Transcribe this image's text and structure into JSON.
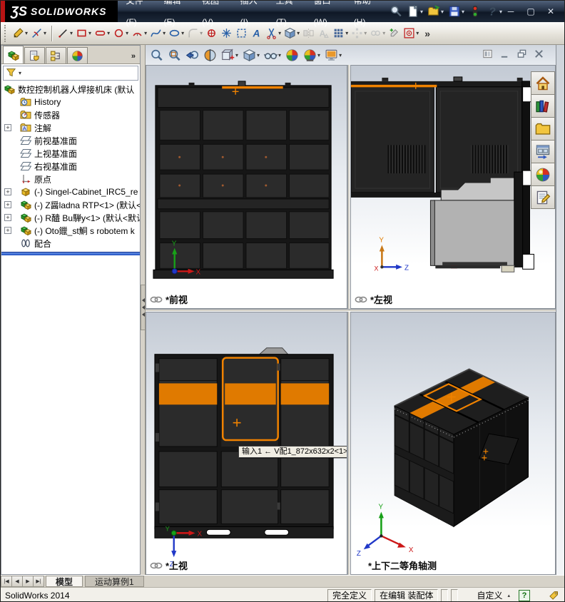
{
  "titlebar": {
    "logo_mark": "ƷS",
    "logo_text": "SOLIDWORKS",
    "menus": [
      "文件(F)",
      "编辑(E)",
      "视图(V)",
      "插入(I)",
      "工具(T)",
      "窗口(W)",
      "帮助(H)"
    ],
    "tools": [
      {
        "name": "search"
      },
      {
        "name": "new-document",
        "dd": true
      },
      {
        "name": "open-document",
        "dd": true
      },
      {
        "name": "save-document",
        "dd": true
      },
      {
        "name": "rebuild-light"
      },
      {
        "name": "help",
        "dd": true
      }
    ],
    "window_controls": [
      {
        "name": "minimize",
        "glyph": "─"
      },
      {
        "name": "restore",
        "glyph": "▢"
      },
      {
        "name": "close",
        "glyph": "✕"
      }
    ]
  },
  "sketch_toolbar": {
    "overflow": "»",
    "items": [
      {
        "name": "sketch",
        "dd": true
      },
      {
        "name": "smart-dimension",
        "dd": true
      },
      {
        "name": "separator"
      },
      {
        "name": "line",
        "dd": true
      },
      {
        "name": "corner-rectangle",
        "dd": true
      },
      {
        "name": "straight-slot",
        "dd": true
      },
      {
        "name": "circle",
        "dd": true
      },
      {
        "name": "centerpoint-arc",
        "dd": true
      },
      {
        "name": "spline",
        "dd": true
      },
      {
        "name": "ellipse",
        "dd": true
      },
      {
        "name": "sketch-fillet",
        "dd": true,
        "disabled": true
      },
      {
        "name": "point"
      },
      {
        "name": "construction-point"
      },
      {
        "name": "convert-entities"
      },
      {
        "name": "sketch-text"
      },
      {
        "name": "trim-entities",
        "dd": true
      },
      {
        "name": "offset-entities",
        "dd": true
      },
      {
        "name": "mirror-entities",
        "disabled": true
      },
      {
        "name": "spell-checker",
        "disabled": true
      },
      {
        "name": "linear-sketch-pattern",
        "dd": true
      },
      {
        "name": "circular-sketch-pattern",
        "dd": true,
        "disabled": true
      },
      {
        "name": "display-relations",
        "dd": true,
        "disabled": true
      },
      {
        "name": "repair-sketch"
      },
      {
        "name": "quick-snaps",
        "dd": true
      }
    ]
  },
  "headsup_toolbar": [
    {
      "name": "zoom-to-fit"
    },
    {
      "name": "zoom-to-area"
    },
    {
      "name": "previous-view"
    },
    {
      "name": "section-view"
    },
    {
      "name": "view-orientation",
      "dd": true
    },
    {
      "name": "display-style",
      "dd": true
    },
    {
      "name": "hide-show-items",
      "dd": true
    },
    {
      "name": "edit-appearance"
    },
    {
      "name": "apply-scene",
      "dd": true
    },
    {
      "name": "view-settings",
      "dd": true
    }
  ],
  "child_window_controls": [
    {
      "name": "document-window"
    },
    {
      "name": "minimize"
    },
    {
      "name": "restore"
    },
    {
      "name": "close"
    }
  ],
  "left_panel": {
    "tabs": [
      {
        "name": "featuremanager",
        "active": true
      },
      {
        "name": "propertymanager",
        "active": false
      },
      {
        "name": "configurationmanager",
        "active": false
      },
      {
        "name": "displaymanager",
        "active": false
      }
    ],
    "tabs_overflow": "»",
    "filter_arrow": "▾",
    "tree": [
      {
        "icon": "assembly-root",
        "label": "数控控制机器人焊接机床 (默认",
        "root": true
      },
      {
        "icon": "history",
        "label": "History",
        "child": true
      },
      {
        "icon": "sensors",
        "label": "传感器",
        "child": true
      },
      {
        "icon": "annotations",
        "label": "注解",
        "child": true,
        "plus": true
      },
      {
        "icon": "plane",
        "label": "前视基准面",
        "child": true
      },
      {
        "icon": "plane",
        "label": "上视基准面",
        "child": true
      },
      {
        "icon": "plane",
        "label": "右视基准面",
        "child": true
      },
      {
        "icon": "origin",
        "label": "原点",
        "child": true
      },
      {
        "icon": "component-yellow",
        "label": "(-) Singel-Cabinet_IRC5_re",
        "child": true,
        "plus": true
      },
      {
        "icon": "component-green",
        "label": "(-) Z醤ladna RTP<1> (默认<",
        "child": true,
        "plus": true
      },
      {
        "icon": "component-green",
        "label": "(-) R醠 Bu騨y<1> (默认<默认",
        "child": true,
        "plus": true
      },
      {
        "icon": "component-green",
        "label": "(-) Oto鑞_st鮦 s robotem k",
        "child": true,
        "plus": true
      },
      {
        "icon": "mates",
        "label": "配合",
        "child": true
      }
    ]
  },
  "task_pane": [
    {
      "name": "solidworks-resources"
    },
    {
      "name": "design-library"
    },
    {
      "name": "file-explorer"
    },
    {
      "name": "view-palette"
    },
    {
      "name": "appearances-scenes"
    },
    {
      "name": "custom-properties"
    }
  ],
  "viewports": [
    {
      "label": "*前视",
      "linked": true,
      "axis_x": "X",
      "axis_y": "Y"
    },
    {
      "label": "*左视",
      "linked": true,
      "axis_x": "X",
      "axis_y": "Y",
      "axis_z": "Z"
    },
    {
      "label": "*上视",
      "linked": true,
      "axis_x": "X",
      "axis_y": "Y",
      "axis_z": "Z",
      "tooltip": "输入1 ← V配1_872x632x2<1>"
    },
    {
      "label": "*上下二等角轴测",
      "linked": false,
      "axis_x": "X",
      "axis_y": "Y",
      "axis_z": "Z"
    }
  ],
  "document_tabs": {
    "nav": [
      "|◀",
      "◀",
      "▶",
      "▶|"
    ],
    "tabs": [
      {
        "label": "模型",
        "active": true
      },
      {
        "label": "运动算例1",
        "active": false
      }
    ]
  },
  "statusbar": {
    "app_version": "SolidWorks 2014",
    "define_state": "完全定义",
    "edit_state": "在编辑 装配体",
    "custom": "自定义",
    "custom_arrow": "▴",
    "help_badge": "?"
  },
  "colors": {
    "accent_orange": "#f08200",
    "band_orange": "#e07a00",
    "cabinet_dark": "#1e1e1e",
    "splitter_blue": "#2a5ad0"
  }
}
